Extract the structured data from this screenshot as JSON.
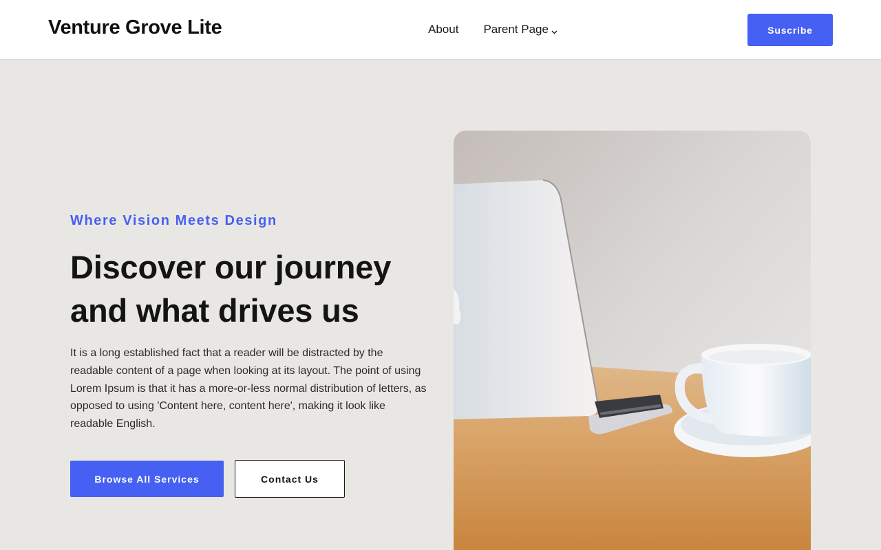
{
  "header": {
    "site_title": "Venture Grove Lite",
    "nav": [
      {
        "label": "About",
        "has_dropdown": false
      },
      {
        "label": "Parent Page",
        "has_dropdown": true
      }
    ],
    "subscribe_label": "Suscribe"
  },
  "hero": {
    "eyebrow": "Where Vision Meets Design",
    "headline": "Discover our journey and what drives us",
    "body": "It is a long established fact that a reader will be distracted by the readable content of a page when looking at its layout. The point of using Lorem Ipsum is that it has a more-or-less normal distribution of letters, as opposed to using 'Content here, content here', making it look like readable English.",
    "primary_button": "Browse All Services",
    "secondary_button": "Contact Us",
    "image": "laptop-and-coffee-cup-photo"
  },
  "colors": {
    "accent": "#4560f2",
    "page_background": "#e9e7e3",
    "header_background": "#ffffff",
    "text": "#111111"
  }
}
